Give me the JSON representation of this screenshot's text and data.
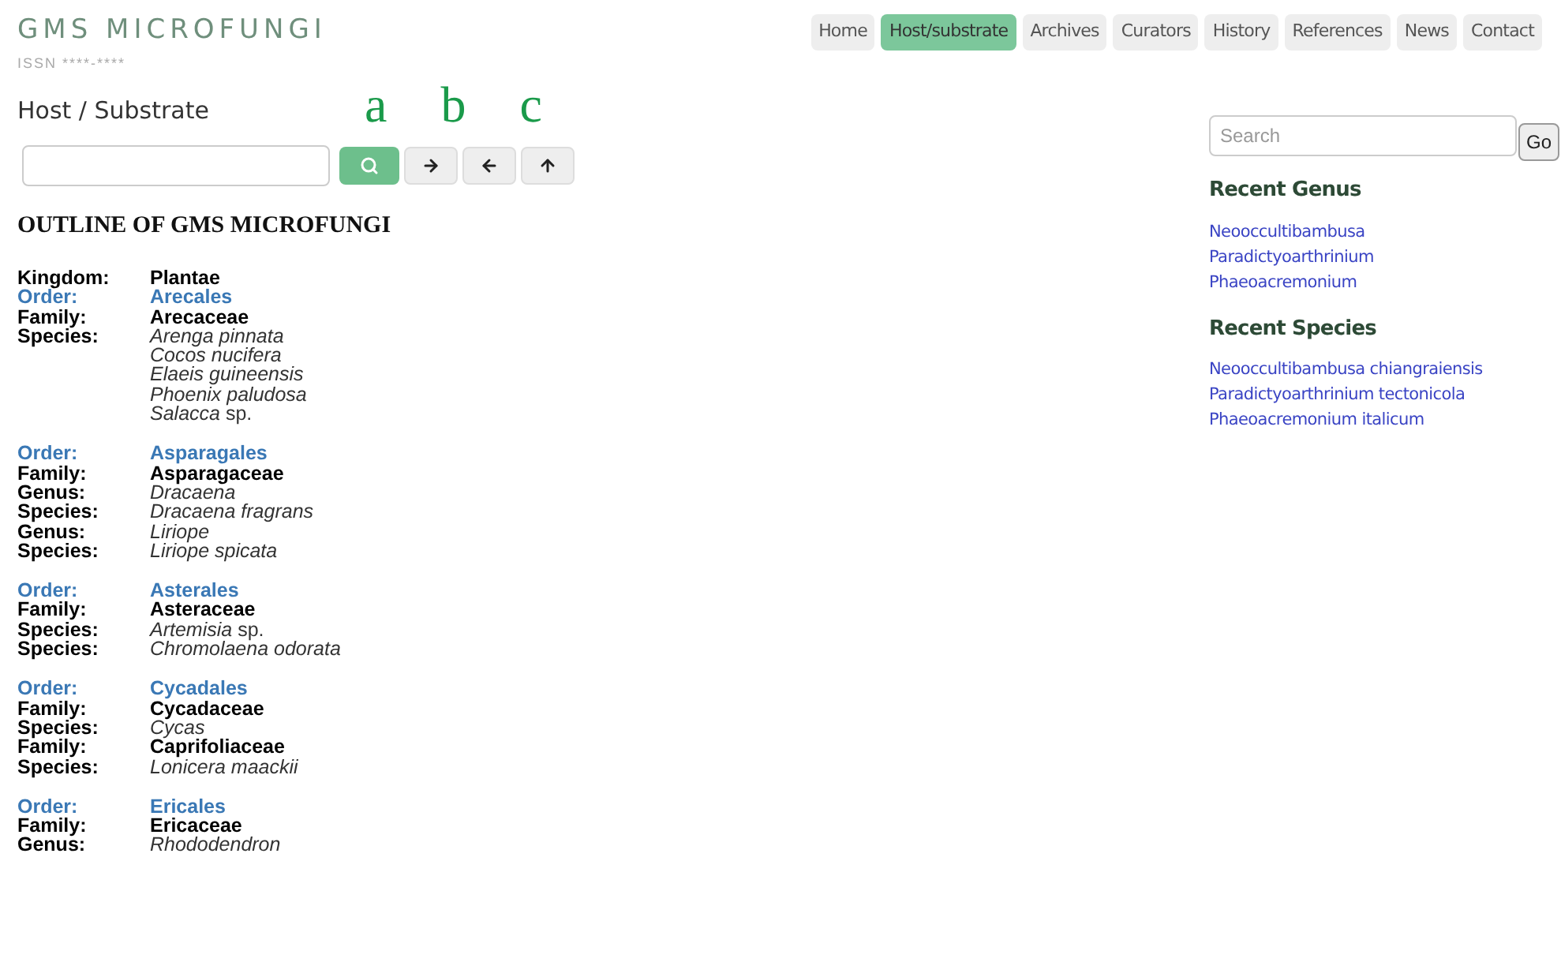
{
  "site": {
    "title": "GMS MICROFUNGI",
    "issn": "ISSN ****-****"
  },
  "nav": [
    {
      "label": "Home",
      "selected": false
    },
    {
      "label": "Host/substrate",
      "selected": true
    },
    {
      "label": "Archives",
      "selected": false
    },
    {
      "label": "Curators",
      "selected": false
    },
    {
      "label": "History",
      "selected": false
    },
    {
      "label": "References",
      "selected": false
    },
    {
      "label": "News",
      "selected": false
    },
    {
      "label": "Contact",
      "selected": false
    }
  ],
  "page_title": "Host / Substrate",
  "annotations": [
    "a",
    "b",
    "c"
  ],
  "toolbar": {
    "buttons": [
      {
        "kind": "search"
      },
      {
        "kind": "forward"
      },
      {
        "kind": "back"
      },
      {
        "kind": "up"
      }
    ]
  },
  "outline": {
    "heading": "OUTLINE OF GMS MICROFUNGI",
    "groups": [
      {
        "rows": [
          {
            "kind": "kingdom",
            "label": "Kingdom:",
            "value": "Plantae"
          },
          {
            "kind": "order",
            "label": "Order:",
            "value": "Arecales"
          },
          {
            "kind": "family",
            "label": "Family:",
            "value": "Arecaceae"
          },
          {
            "kind": "species",
            "label": "Species:",
            "value": "Arenga pinnata"
          },
          {
            "kind": "species",
            "value": "Cocos nucifera"
          },
          {
            "kind": "species",
            "value": "Elaeis guineensis"
          },
          {
            "kind": "species",
            "value": "Phoenix paludosa"
          },
          {
            "kind": "species",
            "value": "Salacca",
            "suffix": "sp."
          }
        ]
      },
      {
        "rows": [
          {
            "kind": "order",
            "label": "Order:",
            "value": "Asparagales"
          },
          {
            "kind": "family",
            "label": "Family:",
            "value": "Asparagaceae"
          },
          {
            "kind": "genus",
            "label": "Genus:",
            "value": "Dracaena"
          },
          {
            "kind": "species",
            "label": "Species:",
            "value": "Dracaena fragrans"
          },
          {
            "kind": "genus",
            "label": "Genus:",
            "value": "Liriope"
          },
          {
            "kind": "species",
            "label": "Species:",
            "value": "Liriope spicata"
          }
        ]
      },
      {
        "rows": [
          {
            "kind": "order",
            "label": "Order:",
            "value": "Asterales"
          },
          {
            "kind": "family",
            "label": "Family:",
            "value": "Asteraceae"
          },
          {
            "kind": "species",
            "label": "Species:",
            "value": "Artemisia",
            "suffix": "sp."
          },
          {
            "kind": "species",
            "label": "Species:",
            "value": "Chromolaena odorata"
          }
        ]
      },
      {
        "rows": [
          {
            "kind": "order",
            "label": "Order:",
            "value": "Cycadales"
          },
          {
            "kind": "family",
            "label": "Family:",
            "value": "Cycadaceae"
          },
          {
            "kind": "species",
            "label": "Species:",
            "value": "Cycas"
          },
          {
            "kind": "family",
            "label": "Family:",
            "value": "Caprifoliaceae"
          },
          {
            "kind": "species",
            "label": "Species:",
            "value": "Lonicera maackii"
          }
        ]
      },
      {
        "rows": [
          {
            "kind": "order",
            "label": "Order:",
            "value": "Ericales"
          },
          {
            "kind": "family",
            "label": "Family:",
            "value": "Ericaceae"
          },
          {
            "kind": "genus",
            "label": "Genus:",
            "value": "Rhododendron"
          }
        ]
      }
    ]
  },
  "sidebar": {
    "search": {
      "placeholder": "Search",
      "button": "Go"
    },
    "sections": [
      {
        "title": "Recent Genus",
        "links": [
          "Neooccultibambusa",
          "Paradictyoarthrinium",
          "Phaeoacremonium"
        ]
      },
      {
        "title": "Recent Species",
        "links": [
          "Neooccultibambusa chiangraiensis",
          "Paradictyoarthrinium tectonicola",
          "Phaeoacremonium italicum"
        ]
      }
    ]
  }
}
